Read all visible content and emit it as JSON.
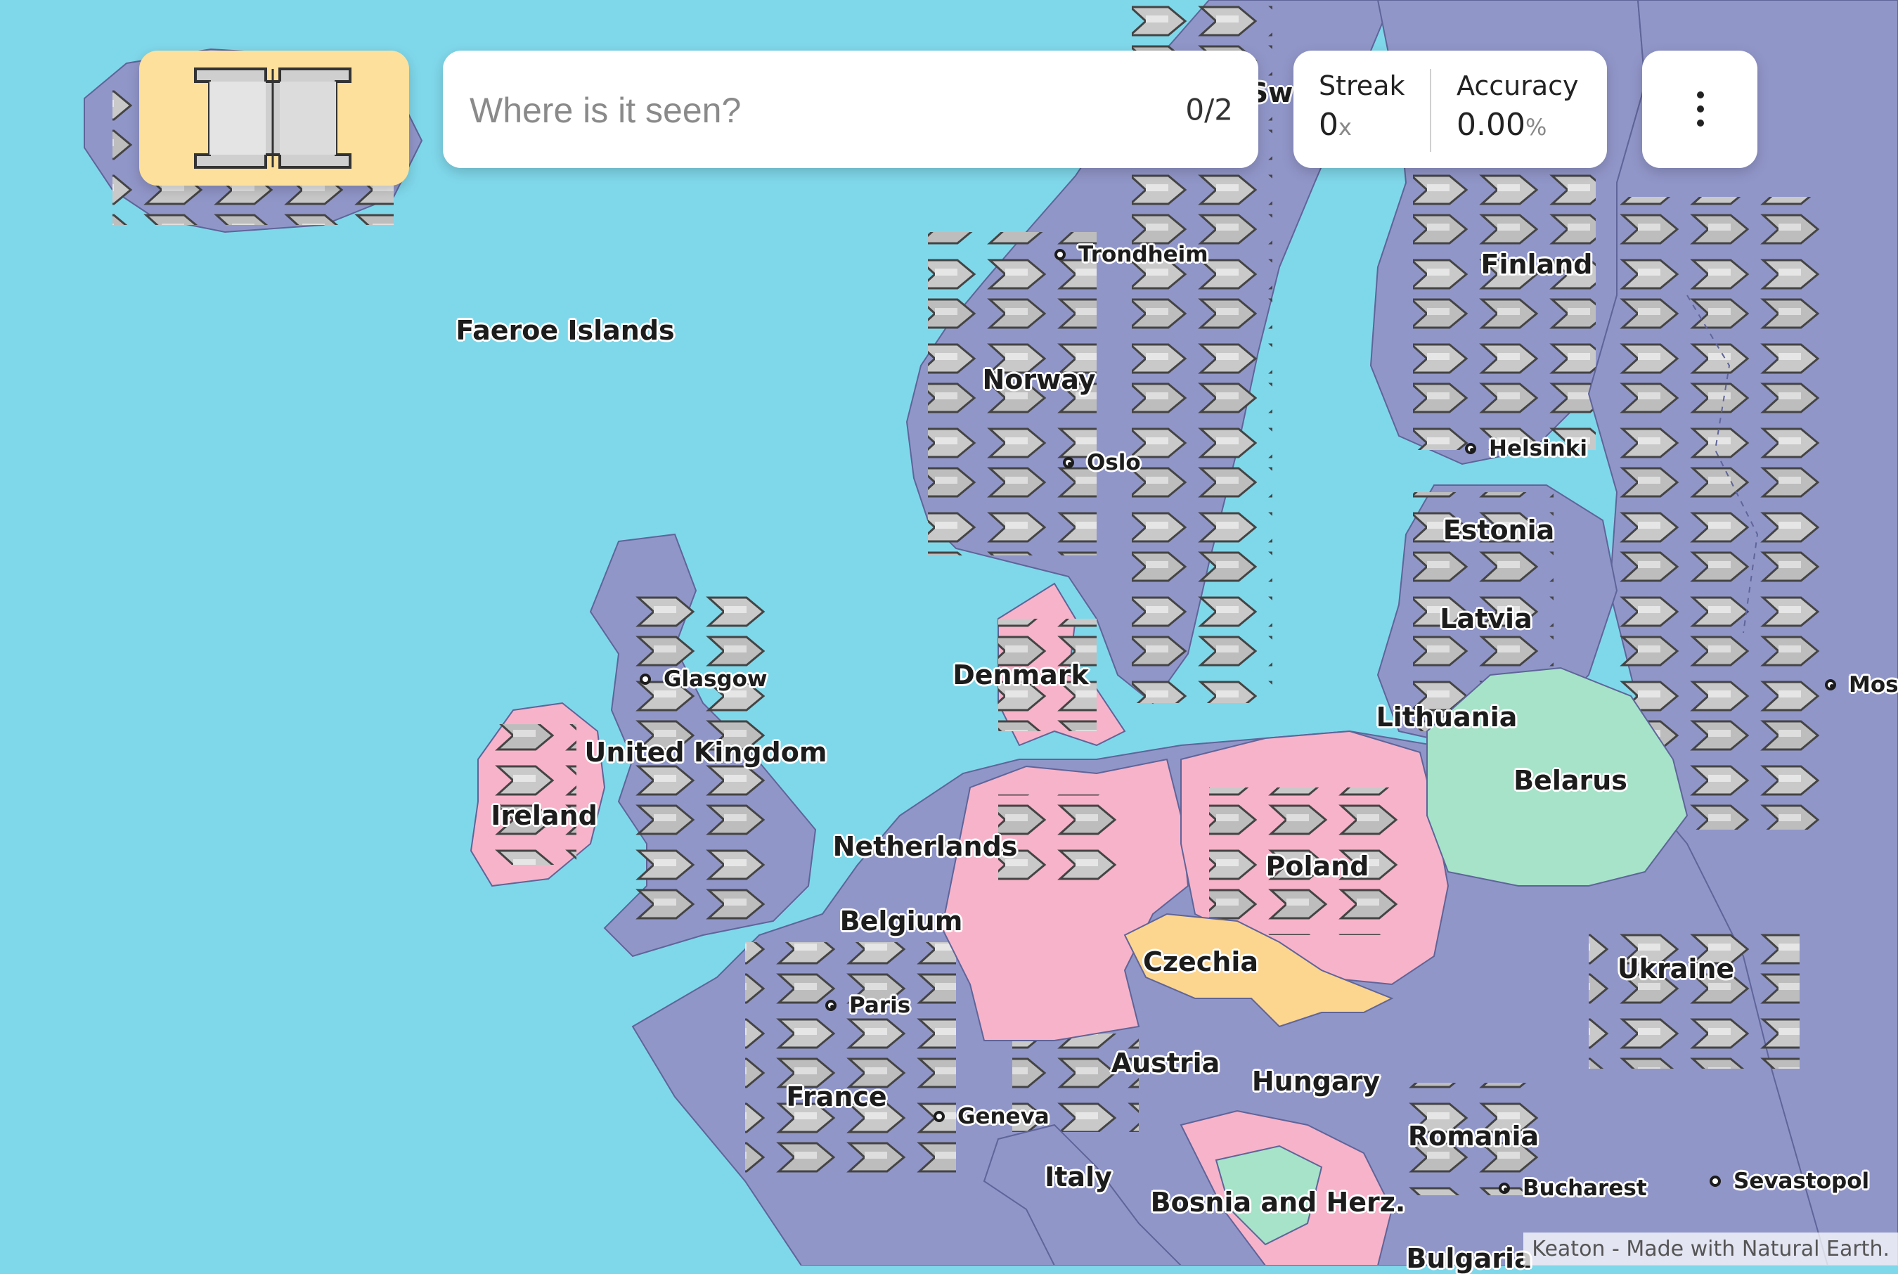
{
  "search": {
    "placeholder": "Where is it seen?",
    "value": "",
    "counter": "0/2"
  },
  "stats": {
    "streak": {
      "title": "Streak",
      "value": "0",
      "unit": "x"
    },
    "accuracy": {
      "title": "Accuracy",
      "value": "0.00",
      "unit": "%"
    }
  },
  "menu": {
    "icon": "more-vertical-icon"
  },
  "flag_icon": "flag-pattern-icon",
  "colors": {
    "sea": "#7fd8ea",
    "land_default": "#9196c9",
    "correct_pink": "#f7b3c9",
    "hint_yellow": "#fcd58f",
    "highlight_green": "#a6e3c9",
    "flag_card": "#fde09c"
  },
  "map": {
    "countries": [
      {
        "key": "sweden",
        "name": "Sw"
      },
      {
        "key": "finland",
        "name": "Finland"
      },
      {
        "key": "faeroe",
        "name": "Faeroe Islands"
      },
      {
        "key": "norway",
        "name": "Norway"
      },
      {
        "key": "estonia",
        "name": "Estonia"
      },
      {
        "key": "latvia",
        "name": "Latvia"
      },
      {
        "key": "denmark",
        "name": "Denmark"
      },
      {
        "key": "lithuania",
        "name": "Lithuania"
      },
      {
        "key": "united_kingdom",
        "name": "United Kingdom"
      },
      {
        "key": "belarus",
        "name": "Belarus"
      },
      {
        "key": "ireland",
        "name": "Ireland"
      },
      {
        "key": "netherlands",
        "name": "Netherlands"
      },
      {
        "key": "poland",
        "name": "Poland"
      },
      {
        "key": "belgium",
        "name": "Belgium"
      },
      {
        "key": "czechia",
        "name": "Czechia"
      },
      {
        "key": "ukraine",
        "name": "Ukraine"
      },
      {
        "key": "austria",
        "name": "Austria"
      },
      {
        "key": "hungary",
        "name": "Hungary"
      },
      {
        "key": "france",
        "name": "France"
      },
      {
        "key": "romania",
        "name": "Romania"
      },
      {
        "key": "italy",
        "name": "Italy"
      },
      {
        "key": "bosnia",
        "name": "Bosnia and Herz."
      },
      {
        "key": "bulgaria",
        "name": "Bulgaria"
      }
    ],
    "cities": [
      {
        "key": "trondheim",
        "name": "Trondheim",
        "capital": false
      },
      {
        "key": "helsinki",
        "name": "Helsinki",
        "capital": true
      },
      {
        "key": "oslo",
        "name": "Oslo",
        "capital": true
      },
      {
        "key": "glasgow",
        "name": "Glasgow",
        "capital": false
      },
      {
        "key": "moscow",
        "name": "Mos",
        "capital": true
      },
      {
        "key": "paris",
        "name": "Paris",
        "capital": true
      },
      {
        "key": "geneva",
        "name": "Geneva",
        "capital": false
      },
      {
        "key": "bucharest",
        "name": "Bucharest",
        "capital": true
      },
      {
        "key": "sevastopol",
        "name": "Sevastopol",
        "capital": false
      }
    ]
  },
  "attribution": "Keaton - Made with Natural Earth."
}
